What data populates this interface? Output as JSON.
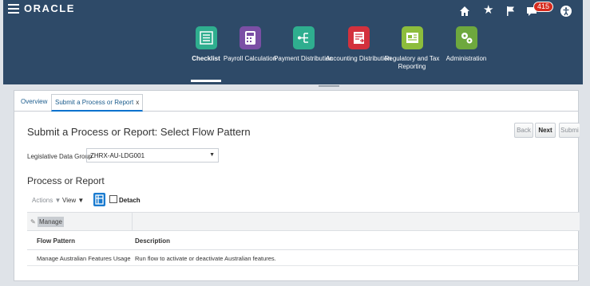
{
  "header": {
    "logo_text": "ORACLE",
    "notification_count": "415",
    "banner_color": "#2e4a68"
  },
  "launchers": [
    {
      "label": "Checklist",
      "color": "#2fae8f",
      "icon": "checklist-icon",
      "selected": true
    },
    {
      "label": "Payroll Calculation",
      "color": "#7b4fa5",
      "icon": "calculator-icon",
      "selected": false
    },
    {
      "label": "Payment Distribution",
      "color": "#2fae8f",
      "icon": "distribution-icon",
      "selected": false
    },
    {
      "label": "Accounting Distribution",
      "color": "#d3313d",
      "icon": "accounting-icon",
      "selected": false
    },
    {
      "label": "Regulatory and Tax Reporting",
      "color": "#8dbd3c",
      "icon": "report-icon",
      "selected": false
    },
    {
      "label": "Administration",
      "color": "#6ea83e",
      "icon": "gears-icon",
      "selected": false
    }
  ],
  "tabs": {
    "overview": "Overview",
    "submit": "Submit a Process or Report",
    "close": "x"
  },
  "page": {
    "title": "Submit a Process or Report: Select Flow Pattern",
    "back": "Back",
    "next": "Next",
    "submit": "Submi",
    "ldg_label": "Legislative Data Group",
    "ldg_value": "ZHRX-AU-LDG001",
    "section_title": "Process or Report",
    "actions": "Actions ▼",
    "view": "View ▼",
    "detach": "Detach",
    "manage": "Manage"
  },
  "table": {
    "columns": [
      "Flow Pattern",
      "Description"
    ],
    "rows": [
      {
        "flow": "Manage Australian Features Usage",
        "desc": "Run flow to activate or deactivate Australian features."
      }
    ]
  }
}
